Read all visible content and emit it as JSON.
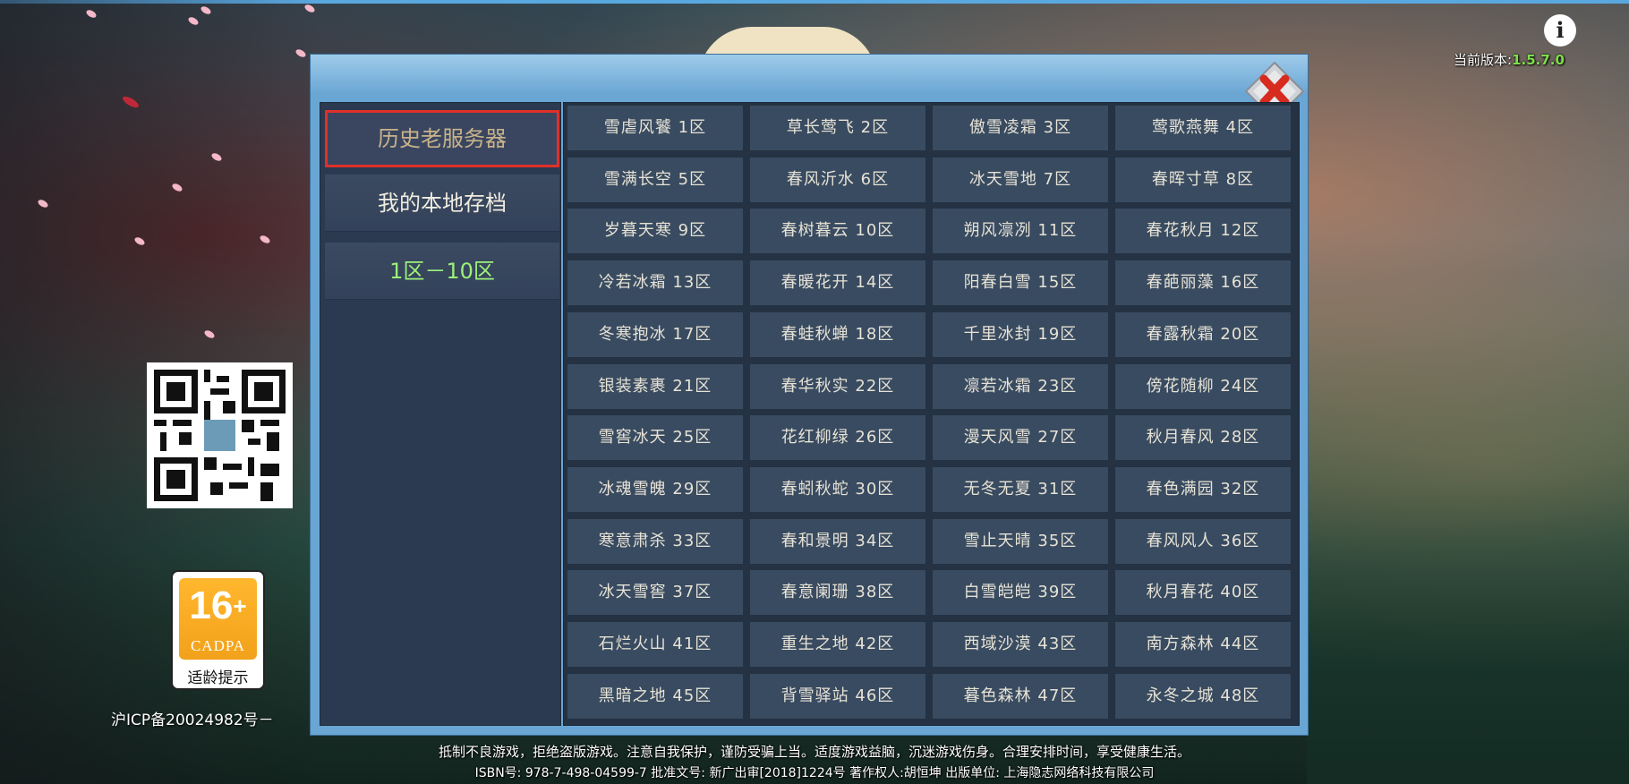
{
  "header": {
    "info_icon": "info-icon",
    "version_label": "当前版本:",
    "version_number": "1.5.7.0"
  },
  "dialog": {
    "close_icon": "close-x-icon",
    "sidebar": [
      {
        "label": "历史老服务器",
        "state": "selected"
      },
      {
        "label": "我的本地存档"
      },
      {
        "label": "1区－10区",
        "accent": "#9cf07a"
      }
    ],
    "servers": [
      "雪虐风饕 1区",
      "草长莺飞 2区",
      "傲雪凌霜 3区",
      "莺歌燕舞 4区",
      "雪满长空 5区",
      "春风沂水 6区",
      "冰天雪地 7区",
      "春晖寸草 8区",
      "岁暮天寒 9区",
      "春树暮云 10区",
      "朔风凛冽 11区",
      "春花秋月 12区",
      "冷若冰霜 13区",
      "春暖花开 14区",
      "阳春白雪 15区",
      "春葩丽藻 16区",
      "冬寒抱冰 17区",
      "春蛙秋蝉 18区",
      "千里冰封 19区",
      "春露秋霜 20区",
      "银装素裹 21区",
      "春华秋实 22区",
      "凛若冰霜 23区",
      "傍花随柳 24区",
      "雪窖冰天 25区",
      "花红柳绿 26区",
      "漫天风雪 27区",
      "秋月春风 28区",
      "冰魂雪魄 29区",
      "春蚓秋蛇 30区",
      "无冬无夏 31区",
      "春色满园 32区",
      "寒意肃杀 33区",
      "春和景明 34区",
      "雪止天晴 35区",
      "春风风人 36区",
      "冰天雪窖 37区",
      "春意阑珊 38区",
      "白雪皑皑 39区",
      "秋月春花 40区",
      "石烂火山 41区",
      "重生之地 42区",
      "西域沙漠 43区",
      "南方森林 44区",
      "黑暗之地 45区",
      "背雪驿站 46区",
      "暮色森林 47区",
      "永冬之城 48区"
    ]
  },
  "left_panel": {
    "qr_icon": "qr-code",
    "age_rating": {
      "number": "16",
      "plus": "+",
      "org": "CADPA",
      "tip": "适龄提示"
    },
    "icp": "沪ICP备20024982号－"
  },
  "footer": {
    "line1": "抵制不良游戏，拒绝盗版游戏。注意自我保护，谨防受骗上当。适度游戏益脑，沉迷游戏伤身。合理安排时间，享受健康生活。",
    "line2": "ISBN号: 978-7-498-04599-7   批准文号: 新广出审[2018]1224号   著作权人:胡恒坤    出版单位: 上海隐志网络科技有限公司"
  },
  "colors": {
    "dialog_frame": "#6aa6d4",
    "panel_bg": "#243244",
    "cell_bg": "#394b60",
    "selected_border": "#e0302a",
    "version_green": "#7ee04a"
  }
}
